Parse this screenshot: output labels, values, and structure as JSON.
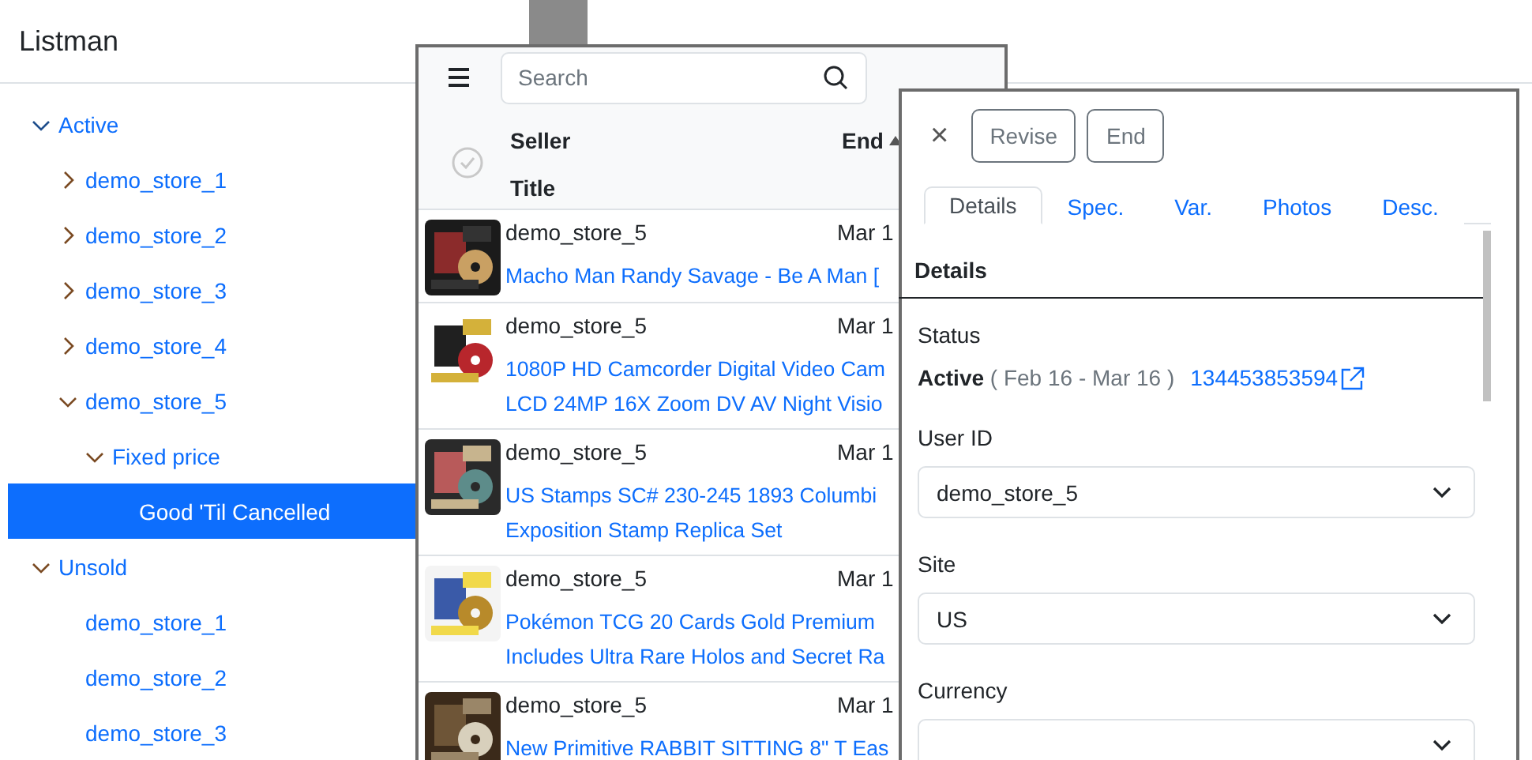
{
  "app": {
    "title": "Listman"
  },
  "tree": [
    {
      "label": "Active",
      "expanded": true,
      "selected": false,
      "children": [
        {
          "label": "demo_store_1",
          "expanded": false,
          "selected": false
        },
        {
          "label": "demo_store_2",
          "expanded": false,
          "selected": false
        },
        {
          "label": "demo_store_3",
          "expanded": false,
          "selected": false
        },
        {
          "label": "demo_store_4",
          "expanded": false,
          "selected": false
        },
        {
          "label": "demo_store_5",
          "expanded": true,
          "selected": false,
          "children": [
            {
              "label": "Fixed price",
              "expanded": true,
              "selected": false,
              "children": [
                {
                  "label": "Good 'Til Cancelled",
                  "selected": true
                }
              ]
            }
          ]
        }
      ]
    },
    {
      "label": "Unsold",
      "expanded": true,
      "selected": false,
      "children": [
        {
          "label": "demo_store_1",
          "selected": false
        },
        {
          "label": "demo_store_2",
          "selected": false
        },
        {
          "label": "demo_store_3",
          "selected": false
        }
      ]
    }
  ],
  "list_panel": {
    "search": {
      "placeholder": "Search"
    },
    "select_all": {
      "checked": false
    },
    "columns": [
      "Seller",
      "Title",
      "End"
    ],
    "rows": [
      {
        "seller": "demo_store_5",
        "end": "Mar 1",
        "title_lines": [
          "Macho Man Randy Savage - Be A Man ["
        ]
      },
      {
        "seller": "demo_store_5",
        "end": "Mar 1",
        "title_lines": [
          "1080P HD Camcorder Digital Video Cam",
          "LCD 24MP 16X Zoom DV AV Night Visio"
        ]
      },
      {
        "seller": "demo_store_5",
        "end": "Mar 1",
        "title_lines": [
          "US Stamps SC# 230-245 1893 Columbi",
          "Exposition Stamp Replica Set"
        ]
      },
      {
        "seller": "demo_store_5",
        "end": "Mar 1",
        "title_lines": [
          "Pokémon TCG 20 Cards Gold Premium",
          "Includes Ultra Rare Holos and Secret Ra"
        ]
      },
      {
        "seller": "demo_store_5",
        "end": "Mar 1",
        "title_lines": [
          "New Primitive RABBIT SITTING 8\" T Eas"
        ]
      }
    ]
  },
  "detail_panel": {
    "close": "×",
    "buttons": [
      "Revise",
      "End"
    ],
    "tabs": [
      {
        "label": "Details",
        "selected": true
      },
      {
        "label": "Spec.",
        "selected": false
      },
      {
        "label": "Var.",
        "selected": false
      },
      {
        "label": "Photos",
        "selected": false
      },
      {
        "label": "Desc.",
        "selected": false
      }
    ],
    "section": "Details",
    "fields": [
      {
        "kind": "status",
        "label": "Status",
        "status": "Active",
        "dates": "( Feb 16 - Mar 16 )",
        "item_number": "134453853594"
      },
      {
        "kind": "select",
        "label": "User ID",
        "value": "demo_store_5"
      },
      {
        "kind": "select",
        "label": "Site",
        "value": "US"
      },
      {
        "kind": "select",
        "label": "Currency"
      }
    ]
  }
}
